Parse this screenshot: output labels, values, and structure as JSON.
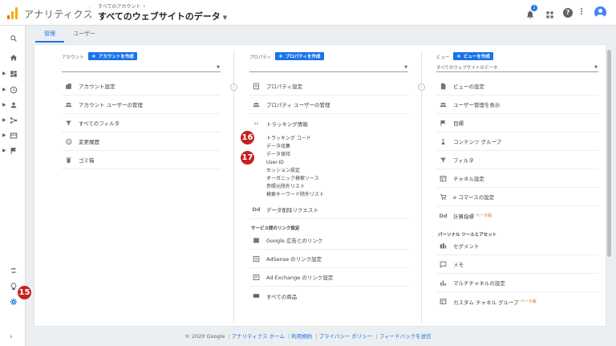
{
  "header": {
    "brand": "アナリティクス",
    "account_breadcrumb": "すべてのアカウント",
    "property_view_title": "すべてのウェブサイトのデータ",
    "notification_count": "2"
  },
  "tabs": [
    {
      "label": "管理",
      "active": true
    },
    {
      "label": "ユーザー",
      "active": false
    }
  ],
  "account_col": {
    "label": "アカウント",
    "create_label": "アカウントを作成",
    "selected": "",
    "items": [
      {
        "label": "アカウント設定",
        "icon": "building-icon"
      },
      {
        "label": "アカウント ユーザーの管理",
        "icon": "users-icon"
      },
      {
        "label": "すべてのフィルタ",
        "icon": "filter-icon"
      },
      {
        "label": "変更履歴",
        "icon": "history-icon"
      },
      {
        "label": "ゴミ箱",
        "icon": "trash-icon"
      }
    ]
  },
  "property_col": {
    "label": "プロパティ",
    "create_label": "プロパティを作成",
    "selected": "",
    "items": [
      {
        "label": "プロパティ設定",
        "icon": "settings-doc-icon"
      },
      {
        "label": "プロパティ ユーザーの管理",
        "icon": "users-icon"
      },
      {
        "label": "トラッキング情報",
        "icon": "code-icon"
      }
    ],
    "tracking_sub": [
      "トラッキング コード",
      "データ収集",
      "データ保持",
      "User-ID",
      "セッション設定",
      "オーガニック検索ソース",
      "参照元除外リスト",
      "検索キーワード除外リスト"
    ],
    "deletion_request": {
      "label": "データ削除リクエスト",
      "icon": "dd-icon"
    },
    "links_section": "サービス間のリンク設定",
    "links": [
      {
        "label": "Google 広告とのリンク",
        "icon": "ads-icon"
      },
      {
        "label": "AdSense のリンク設定",
        "icon": "adsense-icon"
      },
      {
        "label": "Ad Exchange のリンク設定",
        "icon": "adexchange-icon"
      },
      {
        "label": "すべての商品",
        "icon": "products-icon"
      }
    ]
  },
  "view_col": {
    "label": "ビュー",
    "create_label": "ビューを作成",
    "selected": "すべてのウェブサイトのデータ",
    "items": [
      {
        "label": "ビューの設定",
        "icon": "doc-icon"
      },
      {
        "label": "ユーザー管理を表示",
        "icon": "users-icon"
      },
      {
        "label": "目標",
        "icon": "flag-icon"
      },
      {
        "label": "コンテンツ グループ",
        "icon": "person-icon"
      },
      {
        "label": "フィルタ",
        "icon": "filter-icon"
      },
      {
        "label": "チャネル設定",
        "icon": "channel-icon"
      },
      {
        "label": "e コマースの設定",
        "icon": "cart-icon"
      },
      {
        "label": "計算指標",
        "icon": "dd-icon",
        "beta": "ベータ版"
      }
    ],
    "personal_section": "パーソナル ツールとアセット",
    "personal": [
      {
        "label": "セグメント",
        "icon": "segment-icon"
      },
      {
        "label": "メモ",
        "icon": "note-icon"
      },
      {
        "label": "マルチチャネルの設定",
        "icon": "bars-icon"
      },
      {
        "label": "カスタム チャネル グループ",
        "icon": "custom-channel-icon",
        "beta": "ベータ版"
      }
    ]
  },
  "callouts": [
    "16",
    "17",
    "15"
  ],
  "footer": {
    "copyright": "© 2020 Google",
    "links": [
      "アナリティクス ホーム",
      "利用規約",
      "プライバシー ポリシー",
      "フィードバックを送信"
    ]
  },
  "colors": {
    "accent": "#1a73e8",
    "callout": "#c5221f",
    "beta": "#e8710a"
  }
}
